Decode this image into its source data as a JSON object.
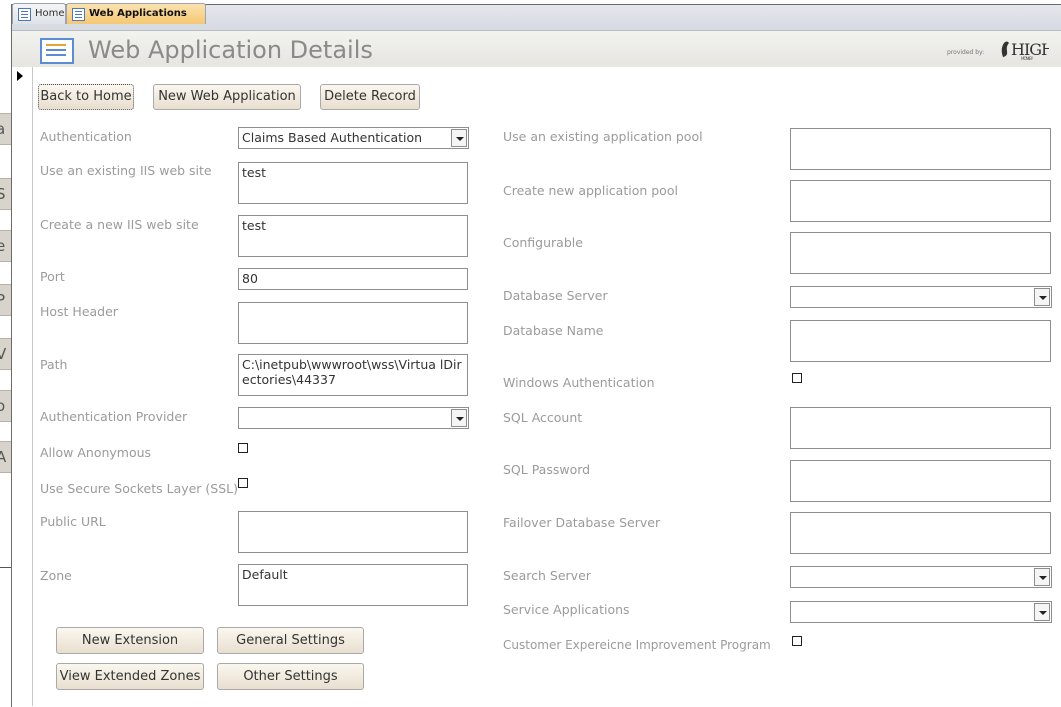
{
  "tabs": [
    {
      "label": "Home"
    },
    {
      "label": "Web Applications"
    }
  ],
  "header": {
    "title": "Web Application Details",
    "logo_caption": "provided by:",
    "logo_text": "HIGH"
  },
  "background_window": {
    "fragments": [
      "a",
      "S",
      "e a",
      "P",
      "V",
      "o",
      "A"
    ]
  },
  "toolbar": {
    "back_label": "Back to Home",
    "new_label": "New Web Application",
    "delete_label": "Delete Record"
  },
  "left_fields": {
    "authentication": {
      "label": "Authentication",
      "value": "Claims Based Authentication"
    },
    "existing_site": {
      "label": "Use an existing IIS web site",
      "value": "test"
    },
    "new_site": {
      "label": "Create a new IIS web site",
      "value": "test"
    },
    "port": {
      "label": "Port",
      "value": "80"
    },
    "host_header": {
      "label": "Host Header",
      "value": ""
    },
    "path": {
      "label": "Path",
      "value": "C:\\inetpub\\wwwroot\\wss\\Virtua lDirectories\\44337"
    },
    "auth_provider": {
      "label": "Authentication Provider",
      "value": ""
    },
    "allow_anonymous": {
      "label": "Allow Anonymous",
      "checked": false
    },
    "use_ssl": {
      "label": "Use Secure Sockets Layer (SSL)",
      "checked": false
    },
    "public_url": {
      "label": "Public URL",
      "value": ""
    },
    "zone": {
      "label": "Zone",
      "value": "Default"
    }
  },
  "right_fields": {
    "existing_pool": {
      "label": "Use an existing application pool",
      "value": ""
    },
    "new_pool": {
      "label": "Create new application pool",
      "value": ""
    },
    "configurable": {
      "label": "Configurable",
      "value": ""
    },
    "db_server": {
      "label": "Database Server",
      "value": ""
    },
    "db_name": {
      "label": "Database Name",
      "value": ""
    },
    "windows_auth": {
      "label": "Windows Authentication",
      "checked": false
    },
    "sql_account": {
      "label": "SQL Account",
      "value": ""
    },
    "sql_password": {
      "label": "SQL Password",
      "value": ""
    },
    "failover_db": {
      "label": "Failover Database Server",
      "value": ""
    },
    "search_server": {
      "label": "Search Server",
      "value": ""
    },
    "service_apps": {
      "label": "Service Applications",
      "value": ""
    },
    "ceip": {
      "label": "Customer Expereicne Improvement Program",
      "checked": false
    }
  },
  "bottom_buttons": {
    "new_extension": "New Extension",
    "general_settings": "General Settings",
    "view_extended_zones": "View Extended Zones",
    "other_settings": "Other Settings"
  }
}
